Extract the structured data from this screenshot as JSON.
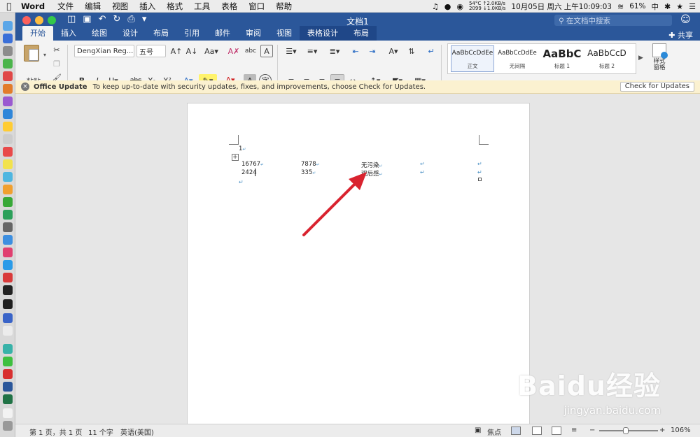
{
  "menubar": {
    "app_name": "Word",
    "items": [
      "文件",
      "编辑",
      "视图",
      "插入",
      "格式",
      "工具",
      "表格",
      "窗口",
      "帮助"
    ],
    "net_up": "54°C ↑2.0KB/s",
    "net_down": "2099 ↓1.0KB/s",
    "datetime": "10月05日 周六 上午10:09:03",
    "battery": "61%",
    "input_method": "中"
  },
  "window": {
    "title": "文档1",
    "search_placeholder": "在文档中搜索",
    "share_label": "共享"
  },
  "tabs": [
    {
      "label": "开始",
      "active": true
    },
    {
      "label": "插入"
    },
    {
      "label": "绘图"
    },
    {
      "label": "设计"
    },
    {
      "label": "布局"
    },
    {
      "label": "引用"
    },
    {
      "label": "邮件"
    },
    {
      "label": "审阅"
    },
    {
      "label": "视图"
    },
    {
      "label": "表格设计",
      "contextual": true
    },
    {
      "label": "布局",
      "contextual": true
    }
  ],
  "ribbon": {
    "paste_label": "粘贴",
    "font_name": "DengXian Reg...",
    "font_size": "五号",
    "styles": [
      {
        "sample": "AaBbCcDdEe",
        "name": "正文",
        "selected": true
      },
      {
        "sample": "AaBbCcDdEe",
        "name": "无间隔"
      },
      {
        "sample": "AaBbC",
        "name": "标题 1"
      },
      {
        "sample": "AaBbCcD",
        "name": "标题 2"
      }
    ],
    "styles_pane_label": "样式\n窗格"
  },
  "update_bar": {
    "title": "Office Update",
    "message": "To keep up-to-date with security updates, fixes, and improvements, choose Check for Updates.",
    "button": "Check for Updates"
  },
  "document": {
    "first_line": "1",
    "table": [
      [
        "16767",
        "7878",
        "无污染"
      ],
      [
        "2424",
        "335",
        "观后感"
      ]
    ]
  },
  "statusbar": {
    "page_info": "第 1 页，共 1 页",
    "word_count": "11 个字",
    "language": "英语(美国)",
    "focus_label": "焦点",
    "zoom": "106%"
  },
  "watermark": {
    "main": "Baidu经验",
    "sub": "jingyan.baidu.com"
  },
  "colors": {
    "word_blue": "#2b579a",
    "update_bar_bg": "#fbf1d0",
    "arrow_red": "#d9232f"
  }
}
